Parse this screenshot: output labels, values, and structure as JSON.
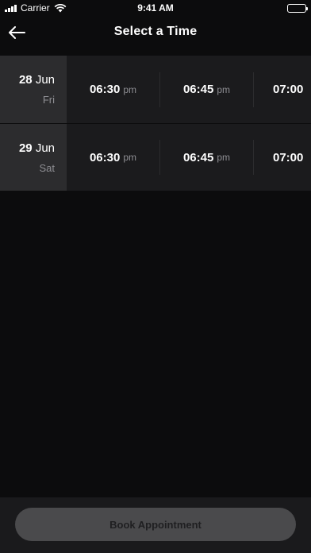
{
  "status_bar": {
    "carrier": "Carrier",
    "time": "9:41 AM"
  },
  "nav": {
    "title": "Select a Time",
    "back_icon": "arrow-left-icon"
  },
  "rows": [
    {
      "date_num": "28",
      "month": "Jun",
      "day": "Fri",
      "slots": [
        {
          "time": "06:30",
          "ampm": "pm"
        },
        {
          "time": "06:45",
          "ampm": "pm"
        },
        {
          "time": "07:00",
          "ampm": ""
        }
      ]
    },
    {
      "date_num": "29",
      "month": "Jun",
      "day": "Sat",
      "slots": [
        {
          "time": "06:30",
          "ampm": "pm"
        },
        {
          "time": "06:45",
          "ampm": "pm"
        },
        {
          "time": "07:00",
          "ampm": ""
        }
      ]
    }
  ],
  "footer": {
    "button_label": "Book Appointment"
  },
  "colors": {
    "background": "#0c0c0d",
    "row": "#1b1b1d",
    "date_panel": "#2c2c2e",
    "button": "#4a4a4c"
  }
}
